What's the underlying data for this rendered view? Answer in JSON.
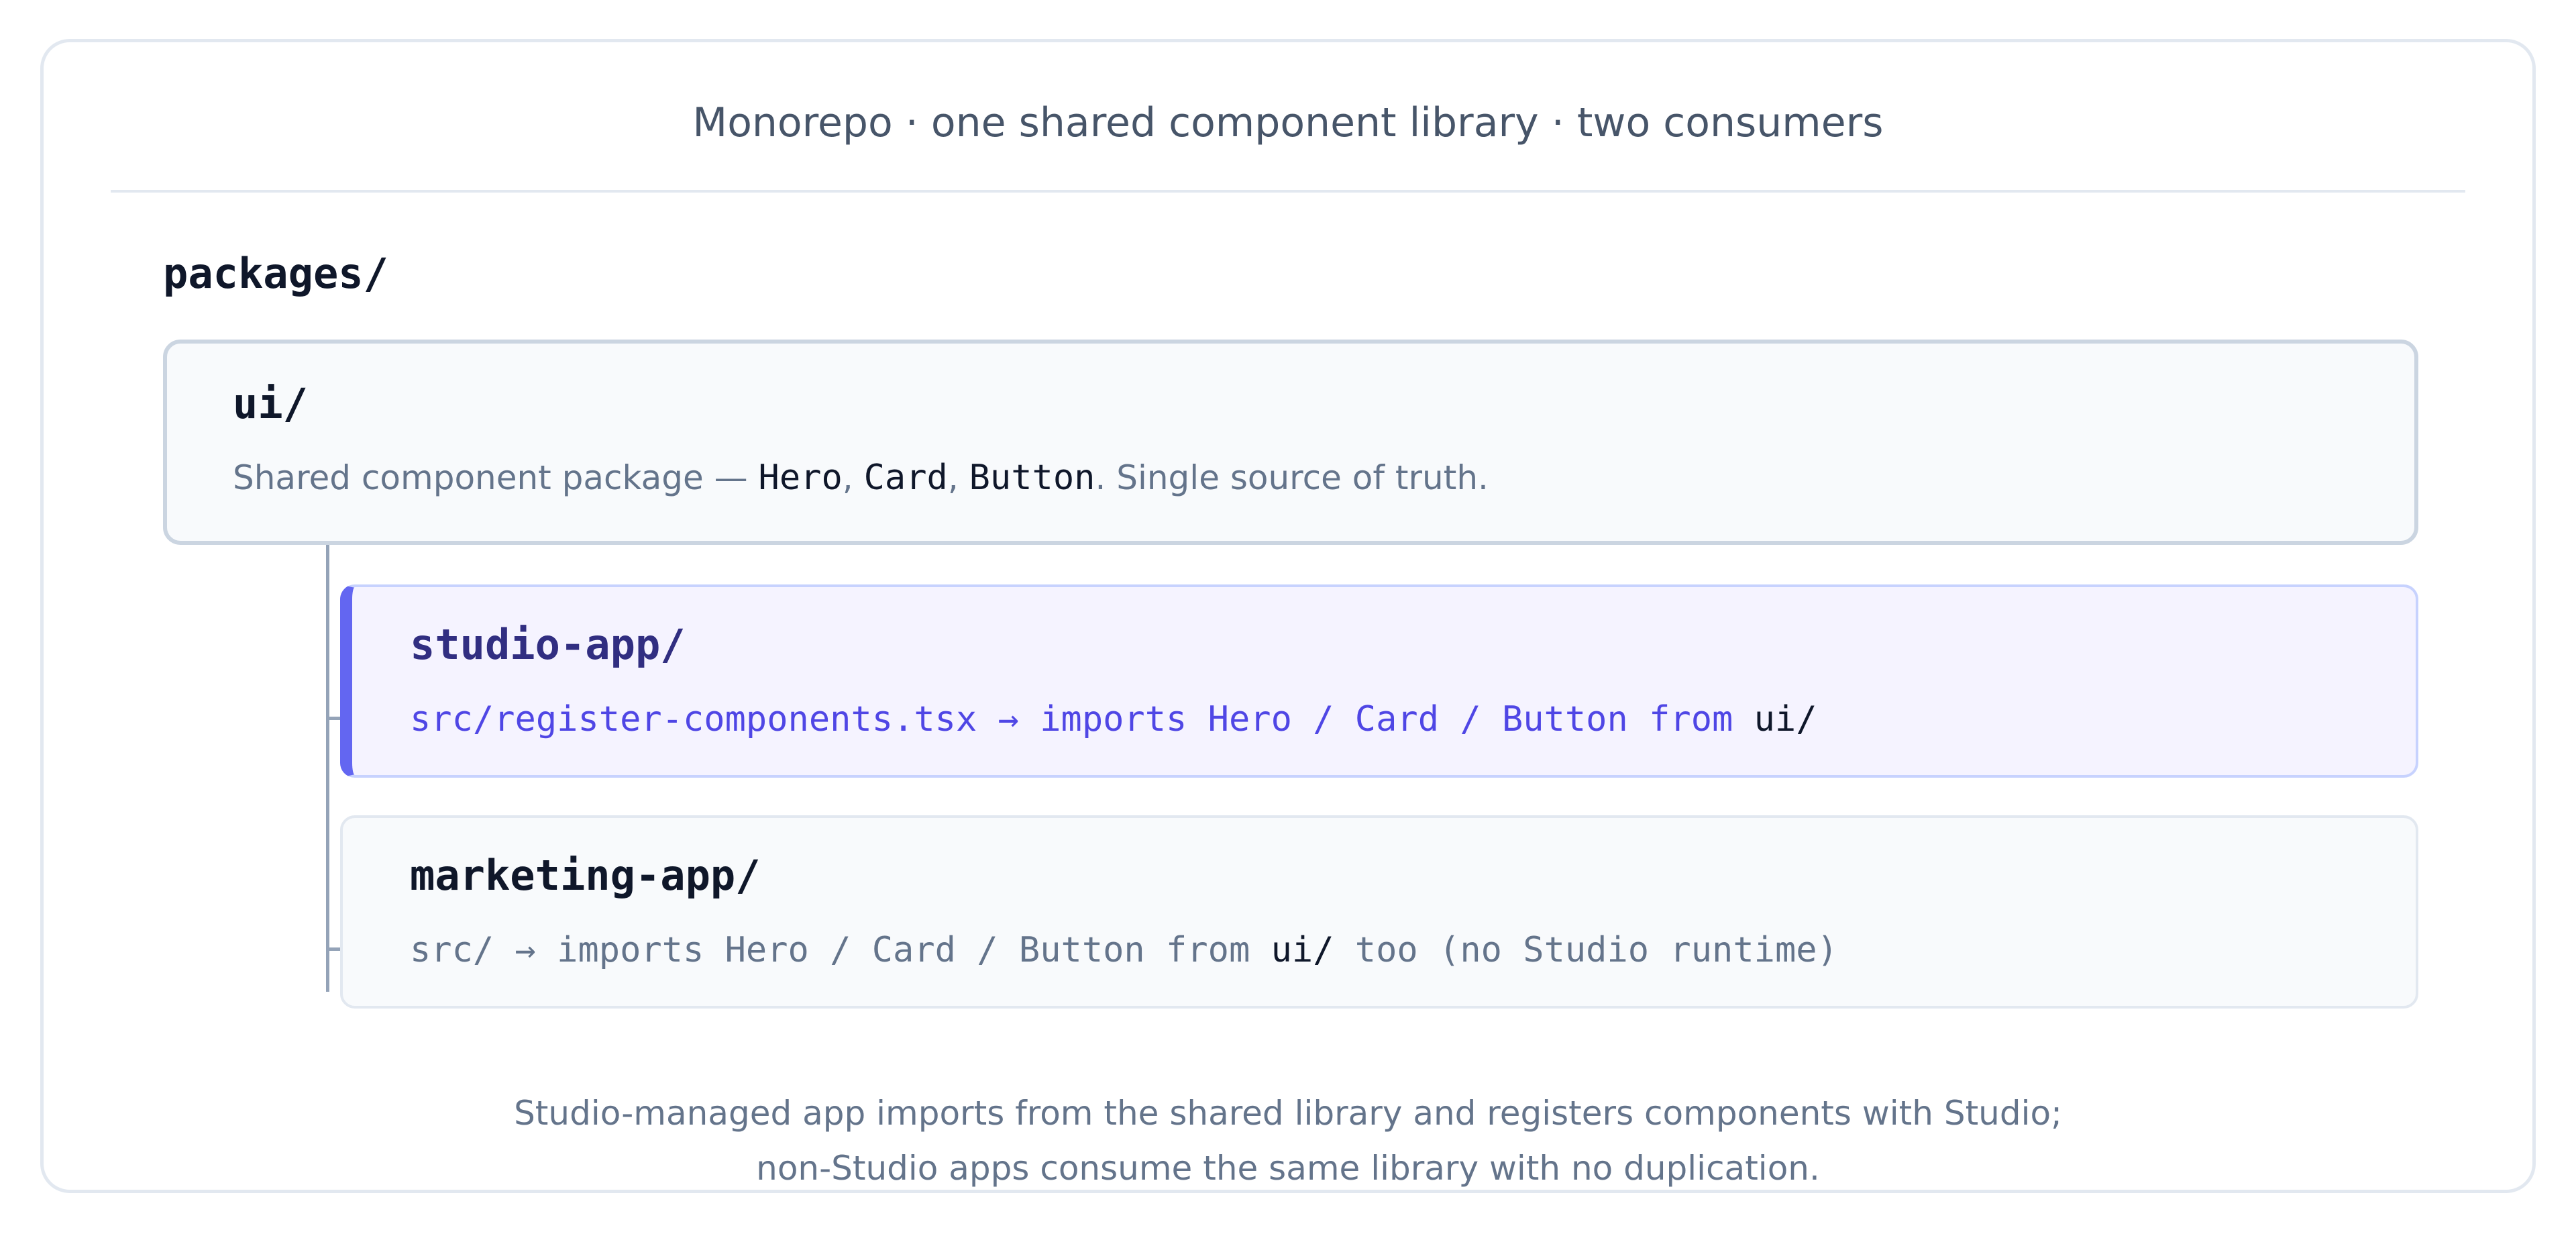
{
  "title": "Monorepo · one shared component library · two consumers",
  "root": {
    "label": "packages/"
  },
  "ui_package": {
    "name": "ui/",
    "desc_prefix": "Shared component package — ",
    "components": [
      "Hero",
      "Card",
      "Button"
    ],
    "sep": ", ",
    "desc_suffix": ". Single source of truth."
  },
  "studio_app": {
    "name": "studio-app/",
    "desc_main": "src/register-components.tsx → imports Hero / Card / Button from ",
    "desc_target": "ui/"
  },
  "marketing_app": {
    "name": "marketing-app/",
    "desc_main": "src/ → imports Hero / Card / Button from ",
    "desc_target": "ui/",
    "desc_suffix": " too (no Studio runtime)"
  },
  "caption": {
    "line1": "Studio-managed app imports from the shared library and registers components with Studio;",
    "line2": "non-Studio apps consume the same library with no duplication."
  },
  "colors": {
    "accent": "#6366f1",
    "studio_bg": "#f5f3ff",
    "studio_text": "#4f46e5",
    "muted_text": "#64748b",
    "border": "#e2e8f0"
  }
}
